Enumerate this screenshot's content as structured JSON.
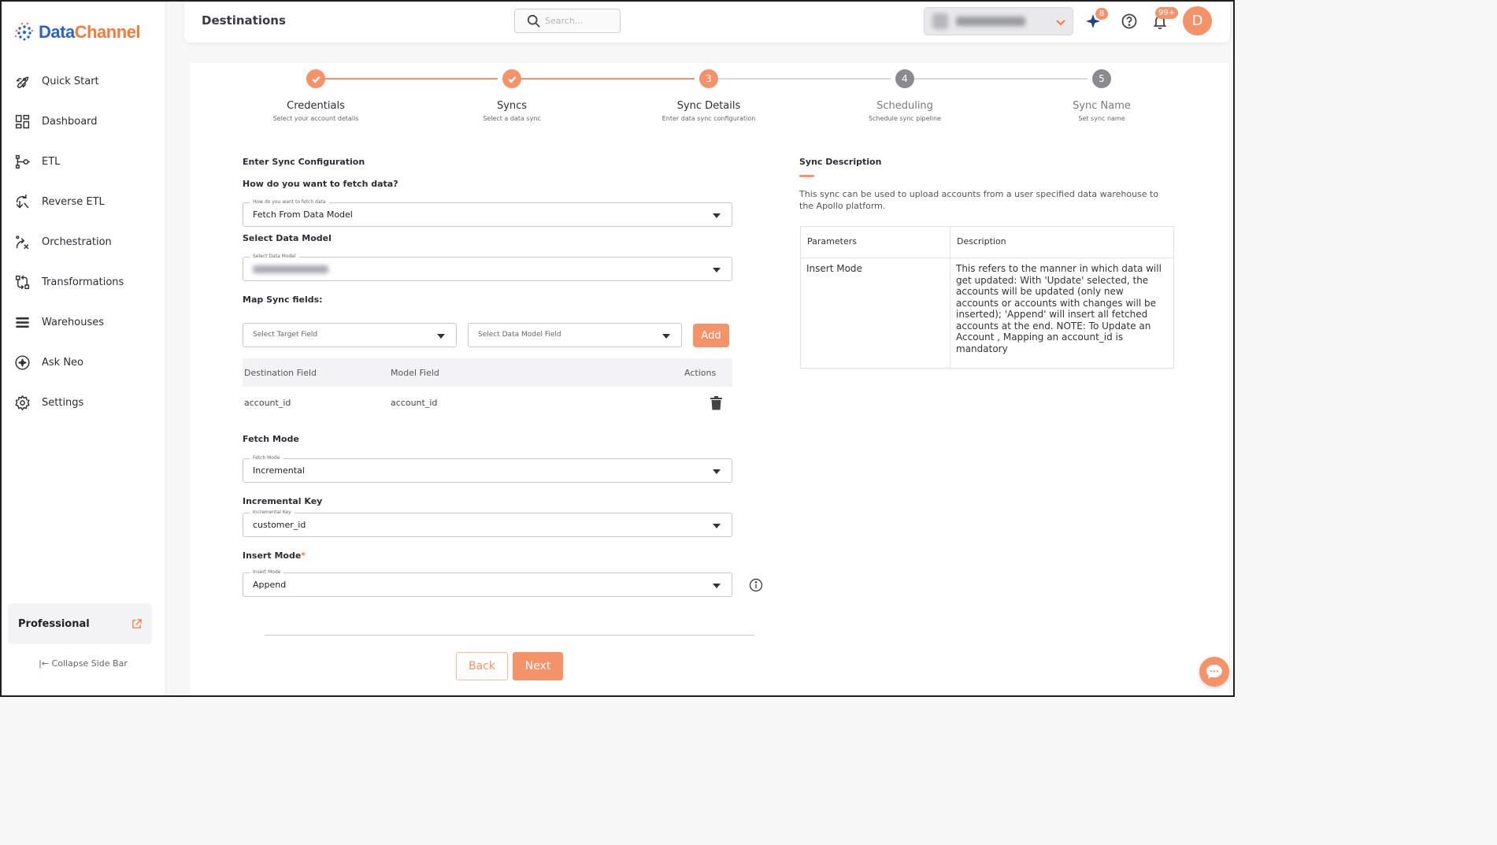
{
  "brand": {
    "name_part1": "Data",
    "name_part2": "Channel"
  },
  "sidebar": {
    "items": [
      {
        "label": "Quick Start",
        "icon": "rocket-icon"
      },
      {
        "label": "Dashboard",
        "icon": "dashboard-grid-icon"
      },
      {
        "label": "ETL",
        "icon": "etl-pipeline-icon"
      },
      {
        "label": "Reverse ETL",
        "icon": "reverse-etl-icon"
      },
      {
        "label": "Orchestration",
        "icon": "orchestration-icon"
      },
      {
        "label": "Transformations",
        "icon": "transformations-icon"
      },
      {
        "label": "Warehouses",
        "icon": "warehouses-icon"
      },
      {
        "label": "Ask Neo",
        "icon": "sparkle-icon"
      },
      {
        "label": "Settings",
        "icon": "gear-icon"
      }
    ],
    "plan": "Professional",
    "collapse_label": "|← Collapse Side Bar"
  },
  "header": {
    "title": "Destinations",
    "search_placeholder": "Search...",
    "ai_badge": "8",
    "notifications_badge": "99+",
    "avatar_initial": "D"
  },
  "stepper": {
    "steps": [
      {
        "number": "1",
        "title": "Credentials",
        "subtitle": "Select your account details",
        "state": "done"
      },
      {
        "number": "2",
        "title": "Syncs",
        "subtitle": "Select a data sync",
        "state": "done"
      },
      {
        "number": "3",
        "title": "Sync Details",
        "subtitle": "Enter data sync configuration",
        "state": "active"
      },
      {
        "number": "4",
        "title": "Scheduling",
        "subtitle": "Schedule sync pipeline",
        "state": "todo"
      },
      {
        "number": "5",
        "title": "Sync Name",
        "subtitle": "Set sync name",
        "state": "todo"
      }
    ]
  },
  "form": {
    "heading": "Enter Sync Configuration",
    "fetch_question": "How do you want to fetch data?",
    "fetch_float": "How do you want to fetch data",
    "fetch_value": "Fetch From Data Model",
    "data_model_label": "Select Data Model",
    "data_model_float": "Select Data Model",
    "map_label": "Map Sync fields:",
    "target_placeholder": "Select Target Field",
    "model_field_placeholder": "Select Data Model Field",
    "add_label": "Add",
    "map_columns": {
      "destination": "Destination Field",
      "model": "Model Field",
      "actions": "Actions"
    },
    "mappings": [
      {
        "destination": "account_id",
        "model": "account_id"
      }
    ],
    "fetch_mode_label": "Fetch Mode",
    "fetch_mode_float": "Fetch Mode",
    "fetch_mode_value": "Incremental",
    "incremental_key_label": "Incremental Key",
    "incremental_key_float": "Incremental Key",
    "incremental_key_value": "customer_id",
    "insert_mode_label": "Insert Mode",
    "insert_mode_required": "*",
    "insert_mode_float": "Insert Mode",
    "insert_mode_value": "Append",
    "back_label": "Back",
    "next_label": "Next"
  },
  "description": {
    "title": "Sync Description",
    "text": "This sync can be used to upload accounts from a user specified data warehouse to the Apollo platform.",
    "table_headers": {
      "parameters": "Parameters",
      "description": "Description"
    },
    "rows": [
      {
        "parameter": "Insert Mode",
        "description": "This refers to the manner in which data will get updated: With 'Update' selected, the accounts will be updated (only new accounts or accounts with changes will be inserted); 'Append' will insert all fetched accounts at the end. NOTE: To Update an Account , Mapping an account_id is mandatory"
      }
    ]
  },
  "colors": {
    "accent": "#f4926a",
    "brand_blue": "#2a65c7",
    "brand_orange": "#f47b3c",
    "step_todo": "#8a8a8f"
  }
}
